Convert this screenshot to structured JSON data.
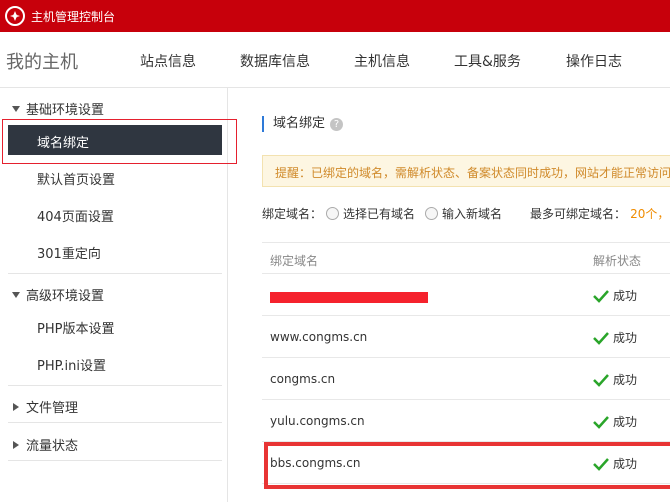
{
  "topbar": {
    "title": "主机管理控制台",
    "logo_icon": "huawei-logo-icon"
  },
  "navbar": {
    "brand": "我的主机",
    "items": [
      {
        "label": "站点信息"
      },
      {
        "label": "数据库信息"
      },
      {
        "label": "主机信息"
      },
      {
        "label": "工具&服务"
      },
      {
        "label": "操作日志"
      }
    ]
  },
  "sidebar": {
    "basic_group": "基础环境设置",
    "basic_items": [
      "域名绑定",
      "默认首页设置",
      "404页面设置",
      "301重定向"
    ],
    "advanced_group": "高级环境设置",
    "advanced_items": [
      "PHP版本设置",
      "PHP.ini设置"
    ],
    "file_group": "文件管理",
    "traffic_group": "流量状态",
    "active_item": "域名绑定"
  },
  "main": {
    "section_title": "域名绑定",
    "help_icon": "?",
    "tip": "提醒：已绑定的域名，需解析状态、备案状态同时成功，网站才能正常访问",
    "bind_label": "绑定域名：",
    "option_existing": "选择已有域名",
    "option_new": "输入新域名",
    "max_label": "最多可绑定域名：",
    "max_count": "20个，",
    "table": {
      "headers": [
        "绑定域名",
        "解析状态"
      ],
      "rows": [
        {
          "domain": "",
          "status": "成功",
          "redacted": true
        },
        {
          "domain": "www.congms.cn",
          "status": "成功"
        },
        {
          "domain": "congms.cn",
          "status": "成功"
        },
        {
          "domain": "yulu.congms.cn",
          "status": "成功"
        },
        {
          "domain": "bbs.congms.cn",
          "status": "成功"
        }
      ]
    }
  },
  "colors": {
    "brand_red": "#c7000b",
    "accent_blue": "#2e7ad8",
    "success_green": "#2aa52a",
    "highlight_red": "#e83434"
  }
}
